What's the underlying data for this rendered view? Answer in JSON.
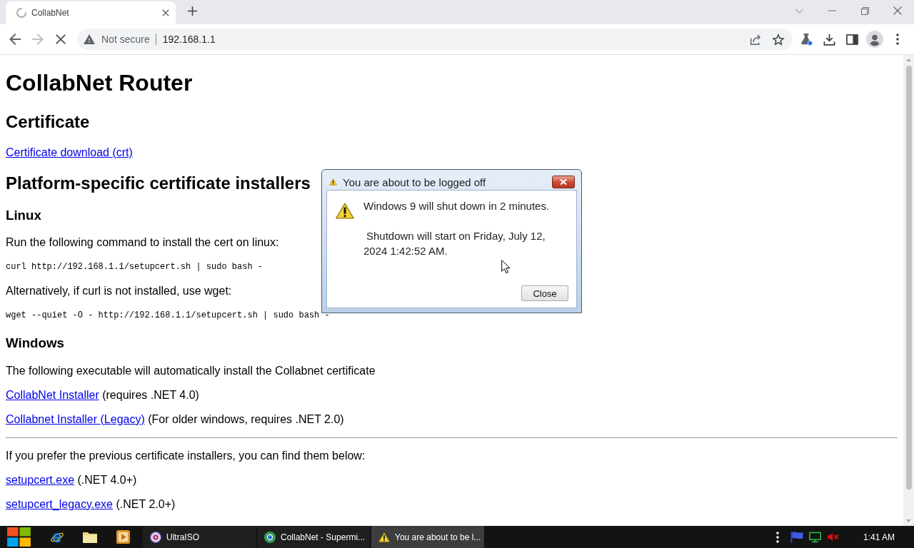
{
  "browser": {
    "tabs": [
      {
        "title": "CollabNet",
        "selected": true
      }
    ],
    "nav_buttons": [
      {
        "kind": "back",
        "disabled": false
      },
      {
        "kind": "forward",
        "disabled": true
      },
      {
        "kind": "stop",
        "disabled": false
      }
    ],
    "address_bar": {
      "security_label": "Not secure",
      "url": "192.168.1.1"
    }
  },
  "page": {
    "blocks": [
      {
        "kind": "h1",
        "text": "CollabNet Router"
      },
      {
        "kind": "h2",
        "text": "Certificate"
      },
      {
        "kind": "p",
        "link": "Certificate download (crt)"
      },
      {
        "kind": "h2",
        "text": "Platform-specific certificate installers"
      },
      {
        "kind": "h3",
        "text": "Linux"
      },
      {
        "kind": "p",
        "text": "Run the following command to install the cert on linux:"
      },
      {
        "kind": "code",
        "text": "curl http://192.168.1.1/setupcert.sh | sudo bash -"
      },
      {
        "kind": "p",
        "text": "Alternatively, if curl is not installed, use wget:"
      },
      {
        "kind": "code",
        "text": "wget --quiet -O - http://192.168.1.1/setupcert.sh | sudo bash -"
      },
      {
        "kind": "h3",
        "text": "Windows"
      },
      {
        "kind": "p",
        "text": "The following executable will automatically install the Collabnet certificate"
      },
      {
        "kind": "p",
        "link": "CollabNet Installer",
        "text": "(requires .NET 4.0)"
      },
      {
        "kind": "p",
        "link": "Collabnet Installer (Legacy)",
        "text": "(For older windows, requires .NET 2.0)"
      },
      {
        "kind": "hr"
      },
      {
        "kind": "p",
        "text": "If you prefer the previous certificate installers, you can find them below:"
      },
      {
        "kind": "p",
        "link": "setupcert.exe",
        "text": "(.NET 4.0+)"
      },
      {
        "kind": "p",
        "link": "setupcert_legacy.exe",
        "text": "(.NET 2.0+)"
      }
    ]
  },
  "dialog": {
    "title": "You are about to be logged off",
    "paragraphs": [
      "Windows 9 will shut down in 2 minutes.",
      "Shutdown will start on Friday, July 12, 2024 1:42:52 AM."
    ],
    "button": "Close"
  },
  "taskbar": {
    "tasks": [
      {
        "kind": "disc",
        "label": "UltraISO",
        "selected": false
      },
      {
        "kind": "browser",
        "label": "CollabNet - Supermi...",
        "selected": false
      },
      {
        "kind": "warning",
        "label": "You are about to be l...",
        "selected": true
      }
    ],
    "clock": "1:41 AM"
  }
}
